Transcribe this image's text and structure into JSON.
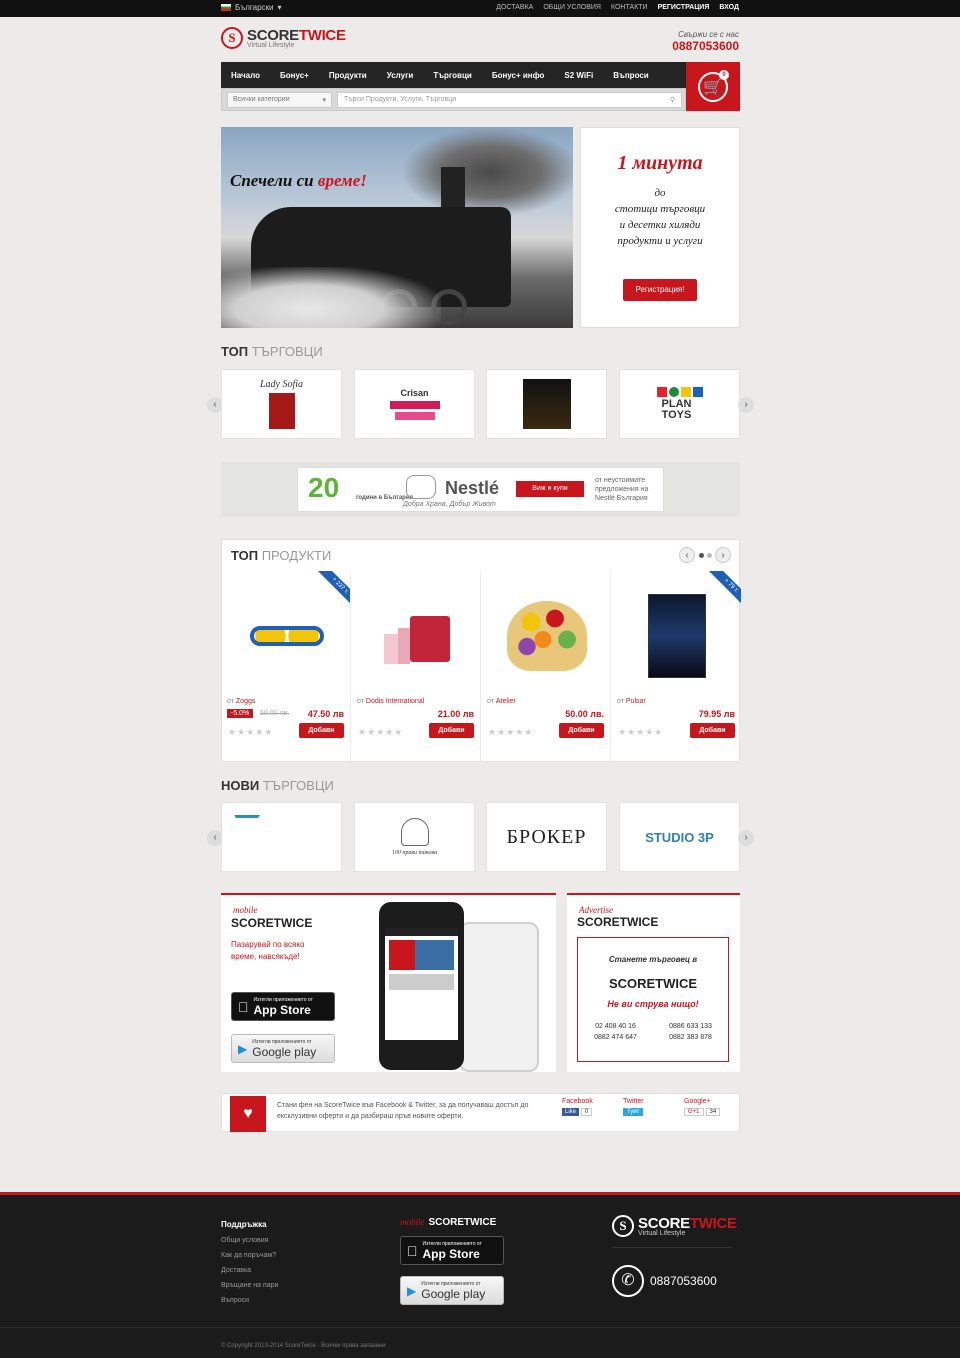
{
  "topbar": {
    "language": "Български",
    "links": [
      "ДОСТАВКА",
      "ОБЩИ УСЛОВИЯ",
      "КОНТАКТИ"
    ],
    "register": "РЕГИСТРАЦИЯ",
    "login": "ВХОД"
  },
  "header": {
    "logo_score": "SCORE",
    "logo_twice": "TWICE",
    "logo_sub": "Virtual Lifestyle",
    "contact_label": "Свържи се с нас",
    "phone": "0887053600"
  },
  "nav": {
    "items": [
      "Начало",
      "Бонус+",
      "Продукти",
      "Услуги",
      "Търговци",
      "Бонус+ инфо",
      "S2 WiFi",
      "Въпроси"
    ]
  },
  "search": {
    "category": "Всички категории",
    "placeholder": "Търси Продукти, Услуги, Търговци"
  },
  "cart": {
    "count": "0"
  },
  "hero": {
    "title_prefix": "Спечели си",
    "title_emph": "време!"
  },
  "promo": {
    "headline": "1 минута",
    "line1": "до",
    "line2": "стотици търговци",
    "line3": "и десетки хиляди",
    "line4": "продукти и услуги",
    "button": "Регистрация!"
  },
  "top_merchants": {
    "title_a": "ТОП",
    "title_b": "ТЪРГОВЦИ",
    "items": [
      "Lady Sofia",
      "Crisan",
      "",
      "PLAN TOYS"
    ]
  },
  "nestle_banner": {
    "years": "20",
    "years_sub": "години в България",
    "brand": "Nestlé",
    "slogan": "Добра Храна, Добър Живот",
    "button": "Виж и купи",
    "desc": "от неустоимите предложения на Nestlé България"
  },
  "top_products": {
    "title_a": "ТОП",
    "title_b": "ПРОДУКТИ",
    "items": [
      {
        "from_label": "от",
        "merchant": "Zoggs",
        "price": "47.50 лв",
        "discount": "-5.0%",
        "old_price": "50.00 лв.",
        "ribbon": "+ 237 т.",
        "add": "Добави"
      },
      {
        "from_label": "от",
        "merchant": "Dodis International",
        "price": "21.00 лв",
        "discount": "",
        "old_price": "",
        "ribbon": "",
        "add": "Добави"
      },
      {
        "from_label": "от",
        "merchant": "Atelier",
        "price": "50.00 лв.",
        "discount": "",
        "old_price": "",
        "ribbon": "",
        "add": "Добави"
      },
      {
        "from_label": "от",
        "merchant": "Pulsar",
        "price": "79.95 лв",
        "discount": "",
        "old_price": "",
        "ribbon": "+ 79 т.",
        "add": "Добави"
      }
    ]
  },
  "new_merchants": {
    "title_a": "НОВИ",
    "title_b": "ТЪРГОВЦИ",
    "items": [
      "",
      "100 прави такова",
      "БРОКЕР",
      "STUDIO 3P"
    ]
  },
  "mobile": {
    "script": "mobile",
    "brand": "SCORETWICE",
    "tagline": "Пазарувай по всяко време, навсякъде!",
    "appstore_small": "Изтегли приложението от",
    "appstore": "App Store",
    "gplay_small": "Изтегли приложението от",
    "gplay": "Google play"
  },
  "advertise": {
    "script": "Advertise",
    "brand": "SCORETWICE",
    "line1": "Станете търговец в",
    "brand2": "SCORETWICE",
    "line2": "Не ви струва нищо!",
    "phones": [
      "02 408 40 16",
      "0886 633 133",
      "0882 474 647",
      "0882 383 878"
    ]
  },
  "social": {
    "text": "Стани фен на ScoreTwice във Facebook & Twitter, за да получаваш достъп до ексклузивни оферти и да разбираш пръв новите оферти.",
    "facebook": "Facebook",
    "fb_btn": "Like",
    "fb_count": "0",
    "twitter": "Twitter",
    "tw_btn": "Туит",
    "google": "Google+",
    "g_btn": "G+1",
    "g_count": "34"
  },
  "footer": {
    "support_title": "Поддръжка",
    "links": [
      "Общи условия",
      "Как да поръчам?",
      "Доставка",
      "Връщане на пари",
      "Въпроси"
    ],
    "mobile_script": "mobile",
    "mobile_brand": "SCORETWICE",
    "appstore": "App Store",
    "gplay": "Google play",
    "store_small": "Изтегли приложението от",
    "logo_score": "SCORE",
    "logo_twice": "TWICE",
    "logo_sub": "Virtual Lifestyle",
    "phone": "0887053600",
    "copyright": "© Copyright 2013-2014 ScoreTwice · Всички права запазени"
  },
  "colors": {
    "accent": "#c8161d",
    "dark": "#252525",
    "ribbon": "#1f5fb4"
  }
}
